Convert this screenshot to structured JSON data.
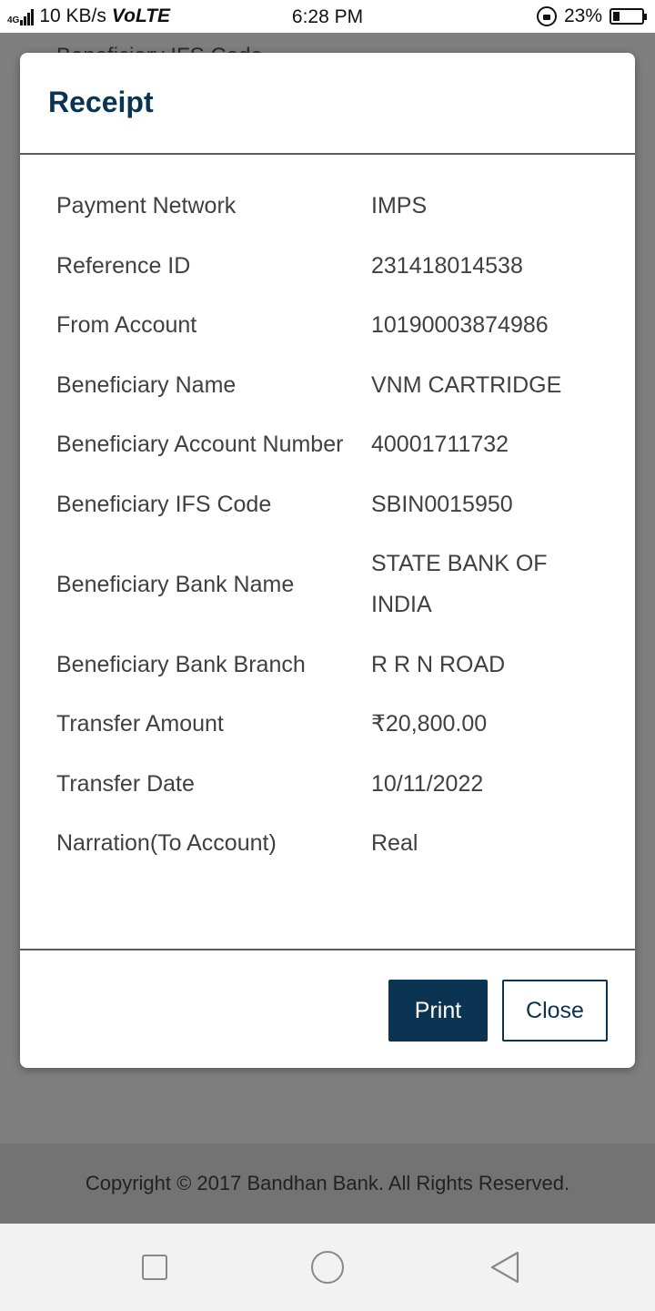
{
  "status_bar": {
    "network": "4G",
    "speed": "10 KB/s",
    "volte": "VoLTE",
    "time": "6:28 PM",
    "battery": "23%",
    "battery_level": 0.23
  },
  "background": {
    "peek_text": "Beneficiary IFS Code",
    "copyright": "Copyright © 2017 Bandhan Bank. All Rights Reserved."
  },
  "modal": {
    "title": "Receipt",
    "rows": [
      {
        "label": "Payment Network",
        "value": "IMPS"
      },
      {
        "label": "Reference ID",
        "value": "231418014538"
      },
      {
        "label": "From Account",
        "value": "10190003874986"
      },
      {
        "label": "Beneficiary Name",
        "value": "VNM CARTRIDGE"
      },
      {
        "label": "Beneficiary Account Number",
        "value": "40001711732"
      },
      {
        "label": "Beneficiary IFS Code",
        "value": "SBIN0015950"
      },
      {
        "label": "Beneficiary Bank Name",
        "value": "STATE BANK OF INDIA"
      },
      {
        "label": "Beneficiary Bank Branch",
        "value": "R R N ROAD"
      },
      {
        "label": "Transfer Amount",
        "value": "₹20,800.00"
      },
      {
        "label": "Transfer Date",
        "value": "10/11/2022"
      },
      {
        "label": "Narration(To Account)",
        "value": "Real"
      }
    ],
    "print_label": "Print",
    "close_label": "Close"
  },
  "colors": {
    "primary": "#0b3352",
    "text": "#404040",
    "overlay": "#7f7f7f"
  }
}
